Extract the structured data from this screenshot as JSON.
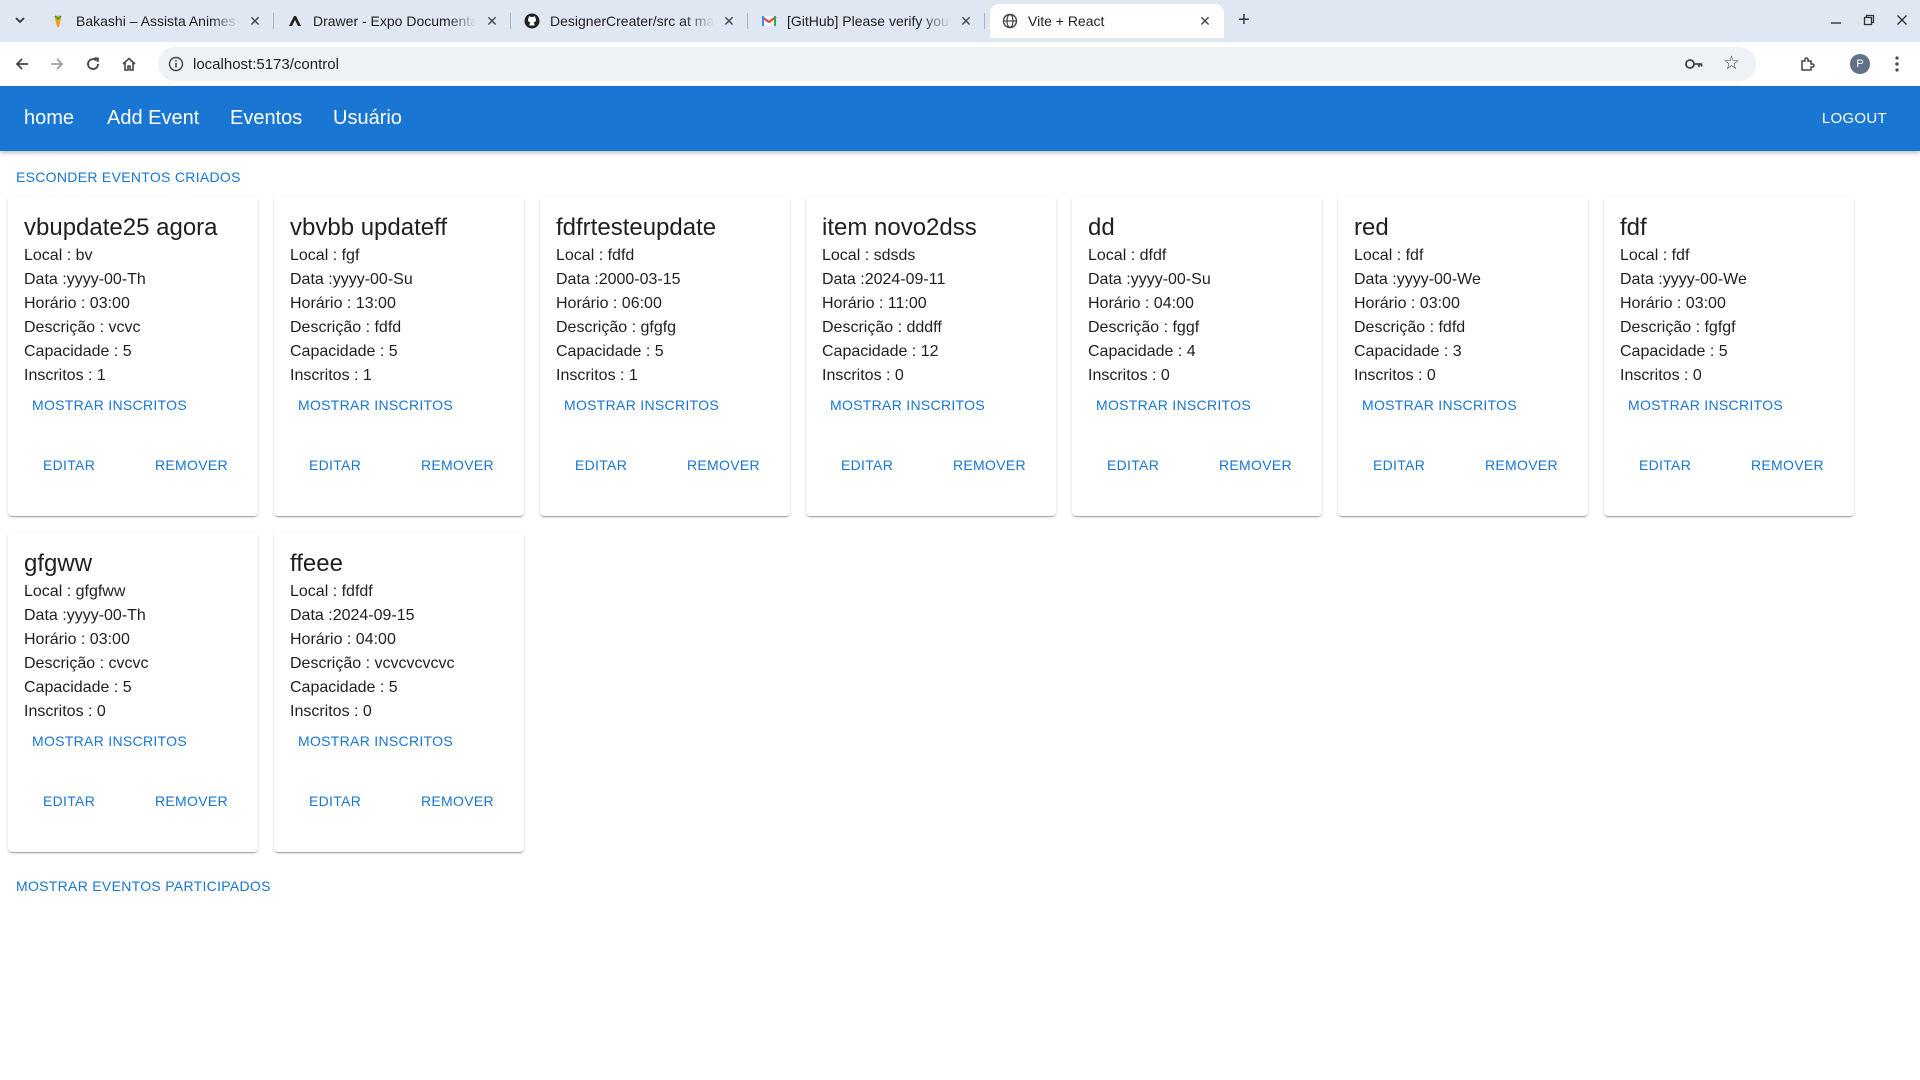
{
  "browser": {
    "tabs": [
      {
        "title": "Bakashi – Assista Animes Grátis",
        "favicon": "bakashi-favicon",
        "active": false
      },
      {
        "title": "Drawer - Expo Documentation",
        "favicon": "expo-favicon",
        "active": false
      },
      {
        "title": "DesignerCreater/src at master",
        "favicon": "github-favicon",
        "active": false
      },
      {
        "title": "[GitHub] Please verify your device",
        "favicon": "gmail-favicon",
        "active": false
      },
      {
        "title": "Vite + React",
        "favicon": "globe-favicon",
        "active": true
      }
    ],
    "url": "localhost:5173/control",
    "profile_initial": "P"
  },
  "app": {
    "nav": [
      "home",
      "Add Event",
      "Eventos",
      "Usuário"
    ],
    "logout": "LOGOUT",
    "toggle_created": "ESCONDER EVENTOS CRIADOS",
    "toggle_participated": "MOSTRAR EVENTOS PARTICIPADOS",
    "colors": {
      "primary": "#1976d2",
      "appbar_text": "#ffffff"
    },
    "labels": {
      "local": "Local : ",
      "data": "Data :",
      "horario": "Horário : ",
      "descricao": "Descrição : ",
      "capacidade": "Capacidade : ",
      "inscritos": "Inscritos : "
    },
    "buttons": {
      "show_subscribers": "MOSTRAR INSCRITOS",
      "edit": "EDITAR",
      "remove": "REMOVER"
    },
    "events": [
      {
        "title": "vbupdate25 agora",
        "local": "bv",
        "data": "yyyy-00-Th",
        "horario": "03:00",
        "descricao": "vcvc",
        "capacidade": "5",
        "inscritos": "1"
      },
      {
        "title": "vbvbb updateff",
        "local": "fgf",
        "data": "yyyy-00-Su",
        "horario": "13:00",
        "descricao": "fdfd",
        "capacidade": "5",
        "inscritos": "1"
      },
      {
        "title": "fdfrtesteupdate",
        "local": "fdfd",
        "data": "2000-03-15",
        "horario": "06:00",
        "descricao": "gfgfg",
        "capacidade": "5",
        "inscritos": "1"
      },
      {
        "title": "item novo2dss",
        "local": "sdsds",
        "data": "2024-09-11",
        "horario": "11:00",
        "descricao": "dddff",
        "capacidade": "12",
        "inscritos": "0"
      },
      {
        "title": "dd",
        "local": "dfdf",
        "data": "yyyy-00-Su",
        "horario": "04:00",
        "descricao": "fggf",
        "capacidade": "4",
        "inscritos": "0"
      },
      {
        "title": "red",
        "local": "fdf",
        "data": "yyyy-00-We",
        "horario": "03:00",
        "descricao": "fdfd",
        "capacidade": "3",
        "inscritos": "0"
      },
      {
        "title": "fdf",
        "local": "fdf",
        "data": "yyyy-00-We",
        "horario": "03:00",
        "descricao": "fgfgf",
        "capacidade": "5",
        "inscritos": "0"
      },
      {
        "title": "gfgww",
        "local": "gfgfww",
        "data": "yyyy-00-Th",
        "horario": "03:00",
        "descricao": "cvcvc",
        "capacidade": "5",
        "inscritos": "0"
      },
      {
        "title": "ffeee",
        "local": "fdfdf",
        "data": "2024-09-15",
        "horario": "04:00",
        "descricao": "vcvcvcvcvc",
        "capacidade": "5",
        "inscritos": "0"
      }
    ]
  }
}
